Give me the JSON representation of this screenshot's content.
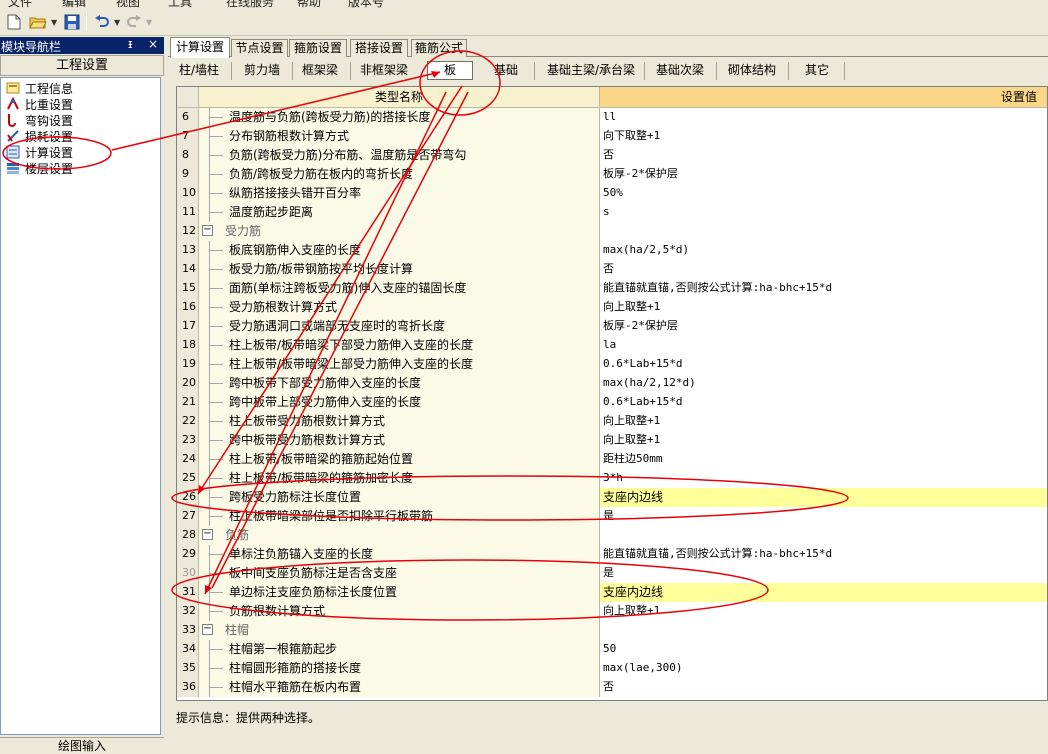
{
  "menubar": [
    "文件",
    "编辑",
    "视图",
    "工具",
    "在线服务",
    "帮助",
    "版本号"
  ],
  "nav": {
    "title": "模块导航栏",
    "pin": "ᵻ",
    "close": "×",
    "project_title": "工程设置",
    "items": [
      {
        "label": "工程信息",
        "icon": "info-icon"
      },
      {
        "label": "比重设置",
        "icon": "weight-icon"
      },
      {
        "label": "弯钩设置",
        "icon": "hook-icon"
      },
      {
        "label": "损耗设置",
        "icon": "loss-icon"
      },
      {
        "label": "计算设置",
        "icon": "calc-icon"
      },
      {
        "label": "楼层设置",
        "icon": "floor-icon"
      }
    ],
    "bottom": "绘图输入"
  },
  "top_tabs": [
    "计算设置",
    "节点设置",
    "箍筋设置",
    "搭接设置",
    "箍筋公式"
  ],
  "sub_tabs": [
    "柱/墙柱",
    "剪力墙",
    "框架梁",
    "非框架梁",
    "板",
    "基础",
    "基础主梁/承台梁",
    "基础次梁",
    "砌体结构",
    "其它"
  ],
  "grid": {
    "col_type": "类型名称",
    "col_value": "设置值",
    "rows": [
      {
        "n": "6",
        "name": "温度筋与负筋(跨板受力筋)的搭接长度",
        "value": "ll"
      },
      {
        "n": "7",
        "name": "分布钢筋根数计算方式",
        "value": "向下取整+1"
      },
      {
        "n": "8",
        "name": "负筋(跨板受力筋)分布筋、温度筋是否带弯勾",
        "value": "否"
      },
      {
        "n": "9",
        "name": "负筋/跨板受力筋在板内的弯折长度",
        "value": "板厚-2*保护层"
      },
      {
        "n": "10",
        "name": "纵筋搭接接头错开百分率",
        "value": "50%"
      },
      {
        "n": "11",
        "name": "温度筋起步距离",
        "value": "s"
      },
      {
        "n": "12",
        "name": "受力筋",
        "value": "",
        "group": true
      },
      {
        "n": "13",
        "name": "板底钢筋伸入支座的长度",
        "value": "max(ha/2,5*d)"
      },
      {
        "n": "14",
        "name": "板受力筋/板带钢筋按平均长度计算",
        "value": "否"
      },
      {
        "n": "15",
        "name": "面筋(单标注跨板受力筋)伸入支座的锚固长度",
        "value": "能直锚就直锚,否则按公式计算:ha-bhc+15*d"
      },
      {
        "n": "16",
        "name": "受力筋根数计算方式",
        "value": "向上取整+1"
      },
      {
        "n": "17",
        "name": "受力筋遇洞口或端部无支座时的弯折长度",
        "value": "板厚-2*保护层"
      },
      {
        "n": "18",
        "name": "柱上板带/板带暗梁下部受力筋伸入支座的长度",
        "value": "la"
      },
      {
        "n": "19",
        "name": "柱上板带/板带暗梁上部受力筋伸入支座的长度",
        "value": "0.6*Lab+15*d"
      },
      {
        "n": "20",
        "name": "跨中板带下部受力筋伸入支座的长度",
        "value": "max(ha/2,12*d)"
      },
      {
        "n": "21",
        "name": "跨中板带上部受力筋伸入支座的长度",
        "value": "0.6*Lab+15*d"
      },
      {
        "n": "22",
        "name": "柱上板带受力筋根数计算方式",
        "value": "向上取整+1"
      },
      {
        "n": "23",
        "name": "跨中板带受力筋根数计算方式",
        "value": "向上取整+1"
      },
      {
        "n": "24",
        "name": "柱上板带/板带暗梁的箍筋起始位置",
        "value": "距柱边50mm"
      },
      {
        "n": "25",
        "name": "柱上板带/板带暗梁的箍筋加密长度",
        "value": "3*h"
      },
      {
        "n": "26",
        "name": "跨板受力筋标注长度位置",
        "value": "支座内边线",
        "hl": true
      },
      {
        "n": "27",
        "name": "柱上板带暗梁部位是否扣除平行板带筋",
        "value": "是"
      },
      {
        "n": "28",
        "name": "负筋",
        "value": "",
        "group": true
      },
      {
        "n": "29",
        "name": "单标注负筋锚入支座的长度",
        "value": "能直锚就直锚,否则按公式计算:ha-bhc+15*d"
      },
      {
        "n": "30",
        "name": "板中间支座负筋标注是否含支座",
        "value": "是",
        "sel": true
      },
      {
        "n": "31",
        "name": "单边标注支座负筋标注长度位置",
        "value": "支座内边线",
        "hl": true
      },
      {
        "n": "32",
        "name": "负筋根数计算方式",
        "value": "向上取整+1"
      },
      {
        "n": "33",
        "name": "柱帽",
        "value": "",
        "group": true
      },
      {
        "n": "34",
        "name": "柱帽第一根箍筋起步",
        "value": "50"
      },
      {
        "n": "35",
        "name": "柱帽圆形箍筋的搭接长度",
        "value": "max(lae,300)"
      },
      {
        "n": "36",
        "name": "柱帽水平箍筋在板内布置",
        "value": "否"
      }
    ]
  },
  "hint": "提示信息：提供两种选择。",
  "colors": {
    "annotation": "#e8000b",
    "header_value_bg": "#fad787",
    "highlight": "#ffff99",
    "nav_header": "#0a246a"
  }
}
